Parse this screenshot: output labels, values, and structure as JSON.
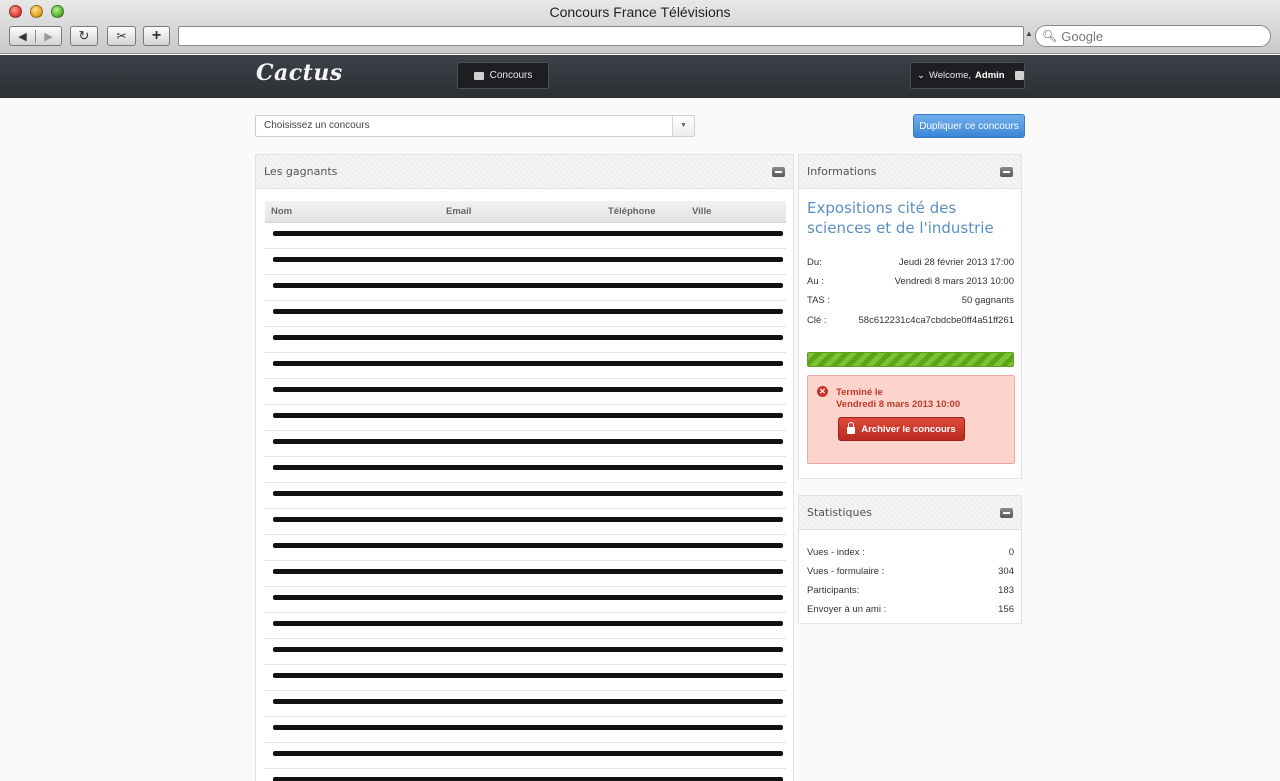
{
  "window": {
    "title": "Concours France Télévisions",
    "search_placeholder": "Google"
  },
  "header": {
    "logo": "Cactus",
    "nav_concours": "Concours",
    "welcome_prefix": "Welcome,",
    "welcome_user": "Admin"
  },
  "toolbar": {
    "select_placeholder": "Choisissez un concours",
    "duplicate_label": "Dupliquer ce concours"
  },
  "winners": {
    "title": "Les gagnants",
    "columns": [
      "Nom",
      "Email",
      "Téléphone",
      "Ville"
    ],
    "rows": 22
  },
  "info": {
    "panel_title": "Informations",
    "contest_title": "Expositions cité des sciences et de l'industrie",
    "fields": [
      {
        "label": "Du:",
        "value": "Jeudi 28 février 2013 17:00"
      },
      {
        "label": "Au :",
        "value": "Vendredi 8 mars 2013 10:00"
      },
      {
        "label": "TAS :",
        "value": "50 gagnants"
      },
      {
        "label": "Clé :",
        "value": "58c612231c4ca7cbdcbe0ff4a51ff261"
      }
    ],
    "progress": 1.0,
    "status_line1": "Terminé le",
    "status_line2": "Vendredi 8 mars 2013 10:00",
    "archive_label": "Archiver le concours"
  },
  "stats": {
    "panel_title": "Statistiques",
    "items": [
      {
        "label": "Vues - index :",
        "value": "0"
      },
      {
        "label": "Vues - formulaire :",
        "value": "304"
      },
      {
        "label": "Participants:",
        "value": "183"
      },
      {
        "label": "Envoyer à un ami :",
        "value": "156"
      }
    ]
  }
}
